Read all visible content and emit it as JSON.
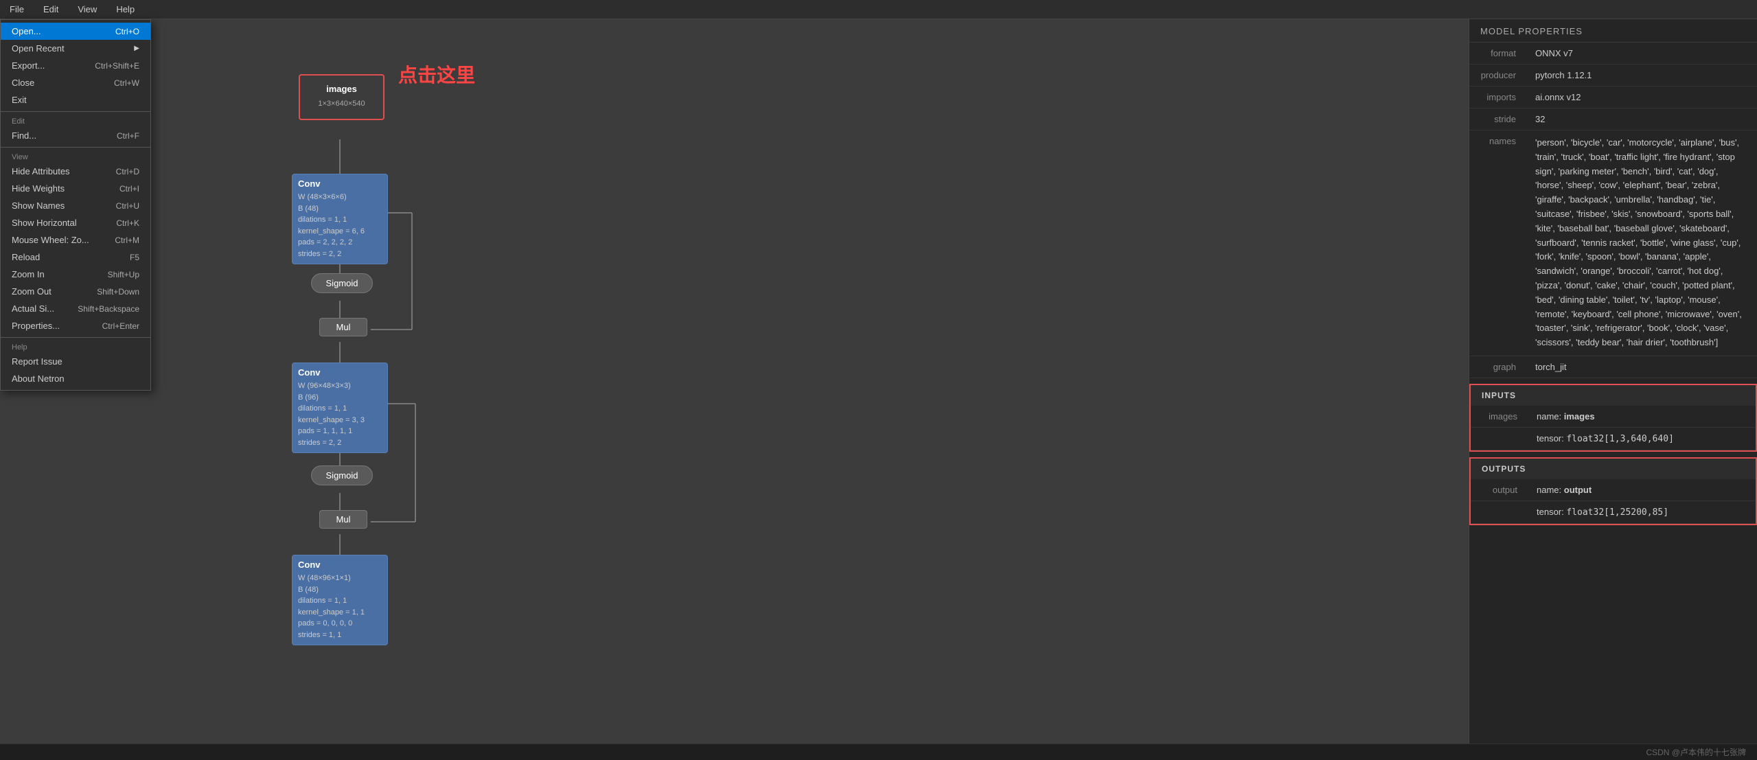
{
  "menubar": {
    "items": [
      "File",
      "Edit",
      "View",
      "Help"
    ]
  },
  "dropdown": {
    "file_section": {
      "open": {
        "label": "Open...",
        "shortcut": "Ctrl+O",
        "active": true
      },
      "open_recent": {
        "label": "Open Recent",
        "shortcut": "",
        "arrow": "▶"
      },
      "export": {
        "label": "Export...",
        "shortcut": "Ctrl+Shift+E"
      },
      "close": {
        "label": "Close",
        "shortcut": "Ctrl+W"
      },
      "exit": {
        "label": "Exit",
        "shortcut": ""
      }
    },
    "edit_section": {
      "label": "Edit",
      "find": {
        "label": "Find...",
        "shortcut": "Ctrl+F"
      }
    },
    "view_section": {
      "label": "View",
      "hide_attributes": {
        "label": "Hide Attributes",
        "shortcut": "Ctrl+D"
      },
      "hide_weights": {
        "label": "Hide Weights",
        "shortcut": "Ctrl+I"
      },
      "show_names": {
        "label": "Show Names",
        "shortcut": "Ctrl+U"
      },
      "show_horizontal": {
        "label": "Show Horizontal",
        "shortcut": "Ctrl+K"
      },
      "mouse_wheel": {
        "label": "Mouse Wheel: Zo...",
        "shortcut": "Ctrl+M"
      },
      "reload": {
        "label": "Reload",
        "shortcut": "F5"
      },
      "zoom_in": {
        "label": "Zoom In",
        "shortcut": "Shift+Up"
      },
      "zoom_out": {
        "label": "Zoom Out",
        "shortcut": "Shift+Down"
      },
      "actual_size": {
        "label": "Actual Si...",
        "shortcut": "Shift+Backspace"
      },
      "properties": {
        "label": "Properties...",
        "shortcut": "Ctrl+Enter"
      }
    },
    "help_section": {
      "label": "Help",
      "report_issue": {
        "label": "Report Issue"
      },
      "about": {
        "label": "About Netron"
      }
    }
  },
  "canvas": {
    "annotation": "点击这里",
    "nodes": {
      "input": {
        "label": "images",
        "dim": "1×3×640×540"
      },
      "conv1": {
        "title": "Conv",
        "w": "W (48×3×6×6)",
        "b": "B (48)",
        "dilations": "dilations = 1, 1",
        "kernel_shape": "kernel_shape = 6, 6",
        "pads": "pads = 2, 2, 2, 2",
        "strides": "strides = 2, 2"
      },
      "sigmoid1": {
        "label": "Sigmoid"
      },
      "mul1": {
        "label": "Mul"
      },
      "conv2": {
        "title": "Conv",
        "w": "W (96×48×3×3)",
        "b": "B (96)",
        "dilations": "dilations = 1, 1",
        "kernel_shape": "kernel_shape = 3, 3",
        "pads": "pads = 1, 1, 1, 1",
        "strides": "strides = 2, 2"
      },
      "sigmoid2": {
        "label": "Sigmoid"
      },
      "mul2": {
        "label": "Mul"
      },
      "conv3": {
        "title": "Conv",
        "w": "W (48×96×1×1)",
        "b": "B (48)",
        "dilations": "dilations = 1, 1",
        "kernel_shape": "kernel_shape = 1, 1",
        "pads": "pads = 0, 0, 0, 0",
        "strides": "strides = 1, 1"
      }
    }
  },
  "right_panel": {
    "title": "MODEL PROPERTIES",
    "properties": {
      "format": {
        "label": "format",
        "value": "ONNX v7"
      },
      "producer": {
        "label": "producer",
        "value": "pytorch 1.12.1"
      },
      "imports": {
        "label": "imports",
        "value": "ai.onnx v12"
      },
      "stride": {
        "label": "stride",
        "value": "32"
      },
      "names": {
        "label": "names",
        "value": "'person', 'bicycle', 'car', 'motorcycle', 'airplane', 'bus', 'train', 'truck', 'boat', 'traffic light', 'fire hydrant', 'stop sign', 'parking meter', 'bench', 'bird', 'cat', 'dog', 'horse', 'sheep', 'cow', 'elephant', 'bear', 'zebra', 'giraffe', 'backpack', 'umbrella', 'handbag', 'tie', 'suitcase', 'frisbee', 'skis', 'snowboard', 'sports ball', 'kite', 'baseball bat', 'baseball glove', 'skateboard', 'surfboard', 'tennis racket', 'bottle', 'wine glass', 'cup', 'fork', 'knife', 'spoon', 'bowl', 'banana', 'apple', 'sandwich', 'orange', 'broccoli', 'carrot', 'hot dog', 'pizza', 'donut', 'cake', 'chair', 'couch', 'potted plant', 'bed', 'dining table', 'toilet', 'tv', 'laptop', 'mouse', 'remote', 'keyboard', 'cell phone', 'microwave', 'oven', 'toaster', 'sink', 'refrigerator', 'book', 'clock', 'vase', 'scissors', 'teddy bear', 'hair drier', 'toothbrush']"
      },
      "graph": {
        "label": "graph",
        "value": "torch_jit"
      }
    },
    "inputs": {
      "section_label": "INPUTS",
      "images": {
        "label": "images",
        "name_label": "name:",
        "name_value": "images",
        "tensor_label": "tensor:",
        "tensor_value": "float32[1,3,640,640]"
      }
    },
    "outputs": {
      "section_label": "OUTPUTS",
      "output": {
        "label": "output",
        "name_label": "name:",
        "name_value": "output",
        "tensor_label": "tensor:",
        "tensor_value": "float32[1,25200,85]"
      }
    }
  },
  "statusbar": {
    "text": "CSDN @卢本伟的十七张牌"
  }
}
